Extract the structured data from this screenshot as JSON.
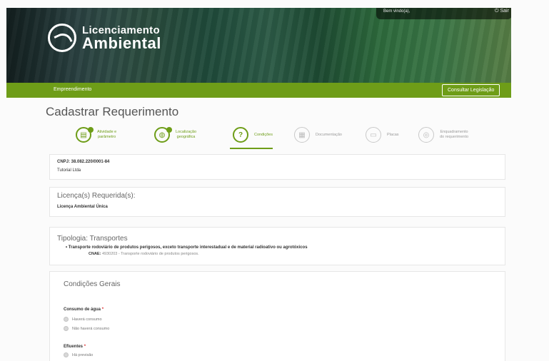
{
  "header": {
    "logo": {
      "line1": "Licenciamento",
      "line2": "Ambiental"
    },
    "user": {
      "welcome": "Bem vindo(a),",
      "logout": "Sair"
    }
  },
  "nav": {
    "item": "Empreendimento",
    "button": "Consultar Legislação"
  },
  "page": {
    "title": "Cadastrar Requerimento"
  },
  "steps": [
    {
      "label": "Atividade e\nparâmetro",
      "state": "done"
    },
    {
      "label": "Localização\ngeográfica",
      "state": "done"
    },
    {
      "label": "Condições",
      "state": "active"
    },
    {
      "label": "Documentação",
      "state": "todo"
    },
    {
      "label": "Placas",
      "state": "todo"
    },
    {
      "label": "Enquadramento\ndo requerimento",
      "state": "todo"
    }
  ],
  "company": {
    "cnpj": "CNPJ: 38.082.220/0001-84",
    "name": "Tutorial Ltda"
  },
  "licenses": {
    "title": "Licença(s) Requerida(s):",
    "value": "Licença Ambiental Única"
  },
  "tipologia": {
    "title": "Tipologia: Transportes",
    "item": "Transporte rodoviário de produtos perigosos, exceto transporte interestadual e de material radioativo ou agrotóxicos",
    "cnae_label": "CNAE:",
    "cnae_value": "4930203 - Transporte rodoviário de produtos perigosos."
  },
  "conditions": {
    "title": "Condições Gerais",
    "water": {
      "label": "Consumo de água",
      "required": "*",
      "options": [
        "Haverá consumo",
        "Não haverá consumo"
      ]
    },
    "effluents": {
      "label": "Efluentes",
      "required": "*",
      "options": [
        "Há previsão"
      ]
    }
  }
}
